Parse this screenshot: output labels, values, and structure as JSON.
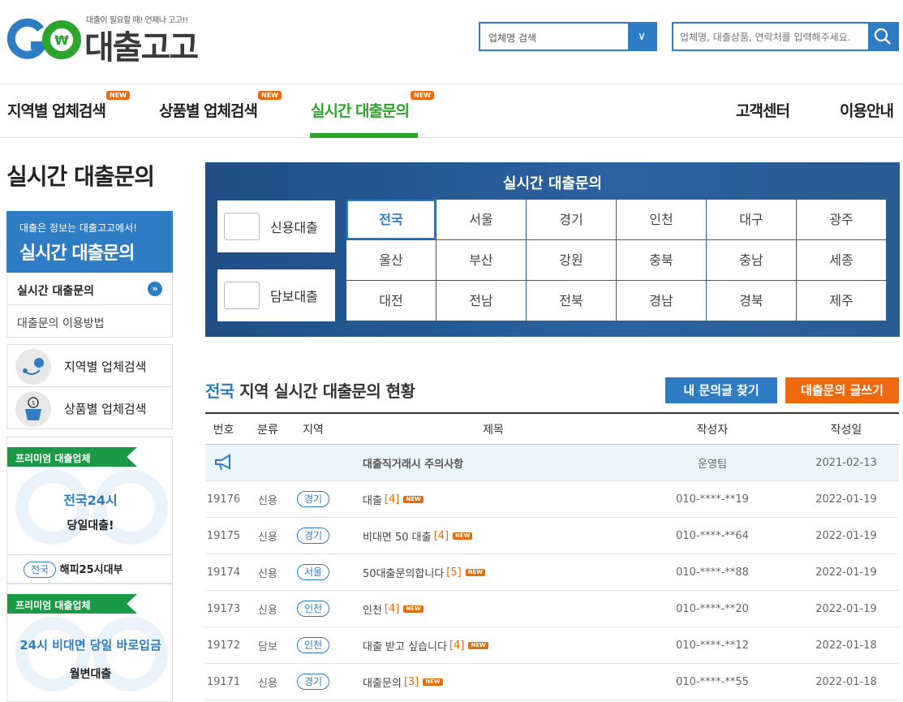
{
  "header": {
    "tagline": "대출이 필요할 때! 언제나 고고!!",
    "logo_text": "대출고고",
    "search_category": "업체명 검색",
    "search_placeholder": "업체명, 대출상품, 연락처를 입력해주세요."
  },
  "nav": {
    "items": [
      {
        "label": "지역별 업체검색",
        "badge": "NEW"
      },
      {
        "label": "상품별 업체검색",
        "badge": "NEW"
      },
      {
        "label": "실시간 대출문의",
        "badge": "NEW",
        "active": true
      }
    ],
    "right": [
      "고객센터",
      "이용안내"
    ]
  },
  "sidebar": {
    "title": "실시간 대출문의",
    "banner_sub": "대출은 정보는 대출고고에서!",
    "banner_title": "실시간 대출문의",
    "menu": [
      "실시간 대출문의",
      "대출문의 이용방법"
    ],
    "links": [
      "지역별 업체검색",
      "상품별 업체검색"
    ],
    "premium_label": "프리미엄 대출업체",
    "premium1": {
      "line1": "전국24시",
      "line2": "당일대출!"
    },
    "premium1_footer": {
      "region": "전국",
      "name": "해피25시대부"
    },
    "premium2": {
      "line1": "24시 비대면 당일 바로입금",
      "line2": "월변대출"
    }
  },
  "hero": {
    "title": "실시간 대출문의",
    "loan_types": [
      "신용대출",
      "담보대출"
    ],
    "regions": [
      "전국",
      "서울",
      "경기",
      "인천",
      "대구",
      "광주",
      "울산",
      "부산",
      "강원",
      "충북",
      "충남",
      "세종",
      "대전",
      "전남",
      "전북",
      "경남",
      "경북",
      "제주"
    ],
    "active_region": "전국"
  },
  "board": {
    "title_highlight": "전국",
    "title_rest": " 지역 실시간 대출문의 현황",
    "btn_find": "내 문의글 찾기",
    "btn_write": "대출문의 글쓰기",
    "columns": [
      "번호",
      "분류",
      "지역",
      "제목",
      "작성자",
      "작성일"
    ],
    "notice": {
      "title": "대출직거래시 주의사항",
      "writer": "운영팀",
      "date": "2021-02-13"
    },
    "rows": [
      {
        "no": "19176",
        "cat": "신용",
        "region": "경기",
        "title": "대출",
        "count": "[4]",
        "writer": "010-****-**19",
        "date": "2022-01-19"
      },
      {
        "no": "19175",
        "cat": "신용",
        "region": "경기",
        "title": "비대면 50 대출",
        "count": "[4]",
        "writer": "010-****-**64",
        "date": "2022-01-19"
      },
      {
        "no": "19174",
        "cat": "신용",
        "region": "서울",
        "title": "50대출문의합니다",
        "count": "[5]",
        "writer": "010-****-**88",
        "date": "2022-01-19"
      },
      {
        "no": "19173",
        "cat": "신용",
        "region": "인천",
        "title": "인천",
        "count": "[4]",
        "writer": "010-****-**20",
        "date": "2022-01-19"
      },
      {
        "no": "19172",
        "cat": "담보",
        "region": "인천",
        "title": "대출 받고 싶습니다",
        "count": "[4]",
        "writer": "010-****-**12",
        "date": "2022-01-18"
      },
      {
        "no": "19171",
        "cat": "신용",
        "region": "경기",
        "title": "대출문의",
        "count": "[3]",
        "writer": "010-****-**55",
        "date": "2022-01-18"
      }
    ],
    "new_badge": "NEW"
  },
  "colors": {
    "brand_blue": "#2e7cc4",
    "brand_green": "#2ca52c",
    "accent_orange": "#f0690f"
  }
}
